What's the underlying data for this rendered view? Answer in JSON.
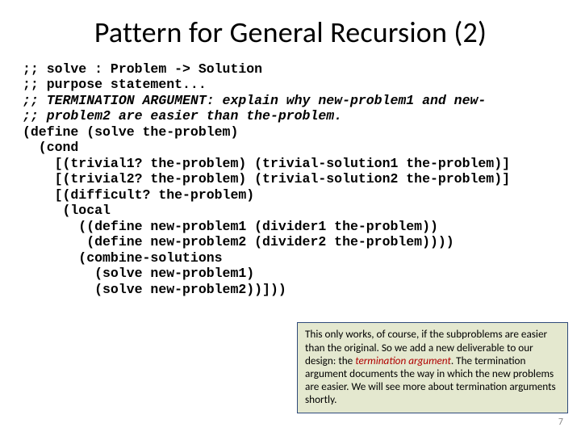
{
  "title": "Pattern for General Recursion (2)",
  "code": {
    "l1": ";; solve : Problem -> Solution",
    "l2": ";; purpose statement...",
    "l3": ";; TERMINATION ARGUMENT: explain why new-problem1 and new-",
    "l4": ";; problem2 are easier than the-problem.",
    "l5": "(define (solve the-problem)",
    "l6": "  (cond",
    "l7": "    [(trivial1? the-problem) (trivial-solution1 the-problem)]",
    "l8": "    [(trivial2? the-problem) (trivial-solution2 the-problem)]",
    "l9": "    [(difficult? the-problem)",
    "l10": "     (local",
    "l11": "       ((define new-problem1 (divider1 the-problem))",
    "l12": "        (define new-problem2 (divider2 the-problem))))",
    "l13": "       (combine-solutions",
    "l14": "         (solve new-problem1)",
    "l15": "         (solve new-problem2))]))"
  },
  "callout": {
    "t1": "This only works, of course, if the subproblems are easier than the original.  So we add a new deliverable to our design:  the ",
    "ta": "termination argument",
    "t2": ".  The termination argument documents the way in which the new problems are easier.  We will see more about termination arguments shortly."
  },
  "pagenum": "7"
}
